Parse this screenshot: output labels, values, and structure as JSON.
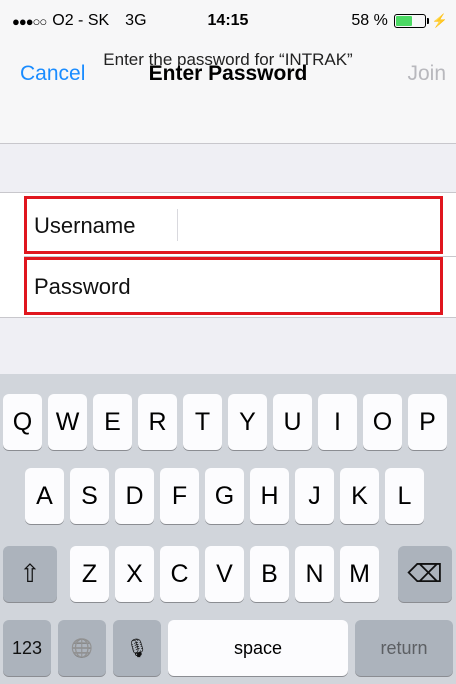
{
  "status_bar": {
    "signal": "●●●○○",
    "carrier": "O2 - SK",
    "network": "3G",
    "time": "14:15",
    "battery_text": "58 %",
    "battery_level": 0.58,
    "charge_icon": "⚡"
  },
  "prompt": "Enter the password for “INTRAK”",
  "nav": {
    "cancel_label": "Cancel",
    "title": "Enter Password",
    "join_label": "Join"
  },
  "form": {
    "username_label": "Username",
    "password_label": "Password"
  },
  "keyboard": {
    "row1": [
      "Q",
      "W",
      "E",
      "R",
      "T",
      "Y",
      "U",
      "I",
      "O",
      "P"
    ],
    "row2": [
      "A",
      "S",
      "D",
      "F",
      "G",
      "H",
      "J",
      "K",
      "L"
    ],
    "row3": [
      "Z",
      "X",
      "C",
      "V",
      "B",
      "N",
      "M"
    ],
    "shift_icon": "⇧",
    "delete_icon": "⌫",
    "numbers_label": "123",
    "globe_icon": "🌐",
    "mic_icon": "🎙",
    "space_label": "space",
    "return_label": "return"
  },
  "colors": {
    "accent": "#1a8cff",
    "highlight_border": "#e0161e",
    "battery_fill": "#4cd964"
  }
}
